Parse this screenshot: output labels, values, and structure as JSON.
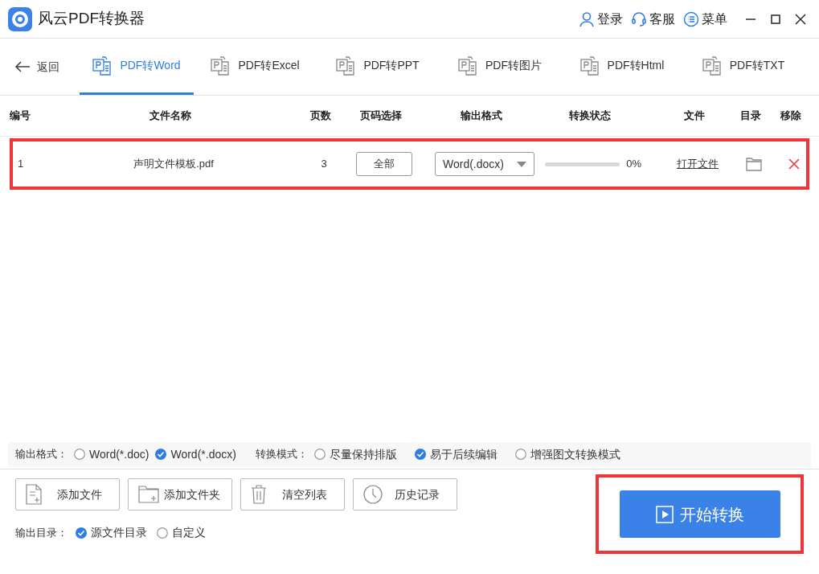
{
  "window": {
    "title": "风云PDF转换器",
    "actions": [
      {
        "label": "登录",
        "kind": "user"
      },
      {
        "label": "客服",
        "kind": "headset"
      },
      {
        "label": "菜单",
        "kind": "menu"
      }
    ]
  },
  "nav": {
    "back": "返回",
    "tabs": [
      {
        "label": "PDF转Word",
        "selected": true
      },
      {
        "label": "PDF转Excel",
        "selected": false
      },
      {
        "label": "PDF转PPT",
        "selected": false
      },
      {
        "label": "PDF转图片",
        "selected": false
      },
      {
        "label": "PDF转Html",
        "selected": false
      },
      {
        "label": "PDF转TXT",
        "selected": false
      }
    ]
  },
  "table": {
    "columns": [
      "编号",
      "文件名称",
      "页数",
      "页码选择",
      "输出格式",
      "转换状态",
      "文件",
      "目录",
      "移除"
    ],
    "rows": [
      {
        "number": "1",
        "file_name": "声明文件模板.pdf",
        "pages": "3",
        "page_range": "全部",
        "format": "Word(.docx)",
        "level": 0,
        "progress": "0%",
        "file_link": "打开文件",
        "highlighted": true
      }
    ]
  },
  "options": {
    "format_label": "输出格式：",
    "formats": [
      {
        "label": "Word(*.doc)",
        "selected": false
      },
      {
        "label": "Word(*.docx)",
        "selected": true
      }
    ],
    "mode_label": "转换模式：",
    "modes": [
      {
        "label": "尽量保持排版",
        "selected": false
      },
      {
        "label": "易于后续编辑",
        "selected": true
      },
      {
        "label": "增强图文转换模式",
        "selected": false
      }
    ]
  },
  "buttons": [
    {
      "label": "添加文件",
      "kind": "file"
    },
    {
      "label": "添加文件夹",
      "kind": "folder"
    },
    {
      "label": "清空列表",
      "kind": "trash"
    },
    {
      "label": "历史记录",
      "kind": "clock"
    }
  ],
  "output_dir": {
    "label": "输出目录：",
    "choices": [
      {
        "label": "源文件目录",
        "selected": true
      },
      {
        "label": "自定义",
        "selected": false
      }
    ]
  },
  "start_button": {
    "label": "开始转换",
    "highlighted": true
  }
}
